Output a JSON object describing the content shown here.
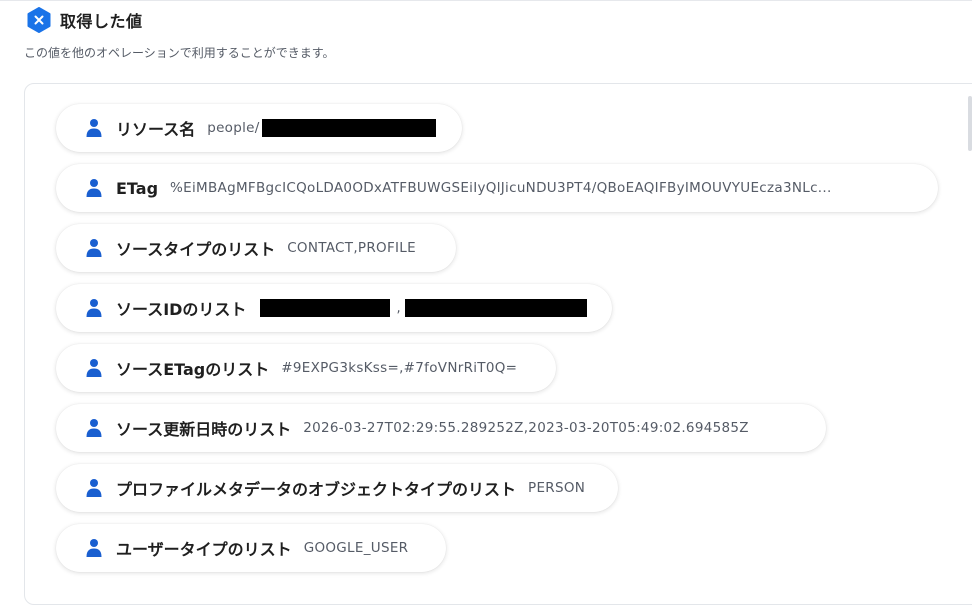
{
  "header": {
    "title": "取得した値",
    "subtitle": "この値を他のオペレーションで利用することができます。",
    "icon": "close-hex-icon",
    "accent": "#1a73e8"
  },
  "fields": [
    {
      "label": "リソース名",
      "value": "people/"
    },
    {
      "label": "ETag",
      "value": "%EiMBAgMFBgcICQoLDA0ODxATFBUWGSEiIyQlJicuNDU3PT4/QBoEAQIFByIMOUVYUEcza3NLc..."
    },
    {
      "label": "ソースタイプのリスト",
      "value": "CONTACT,PROFILE"
    },
    {
      "label": "ソースIDのリスト",
      "value": ","
    },
    {
      "label": "ソースETagのリスト",
      "value": "#9EXPG3ksKss=,#7foVNrRiT0Q="
    },
    {
      "label": "ソース更新日時のリスト",
      "value": "2026-03-27T02:29:55.289252Z,2023-03-20T05:49:02.694585Z"
    },
    {
      "label": "プロファイルメタデータのオブジェクトタイプのリスト",
      "value": "PERSON"
    },
    {
      "label": "ユーザータイプのリスト",
      "value": "GOOGLE_USER"
    }
  ]
}
